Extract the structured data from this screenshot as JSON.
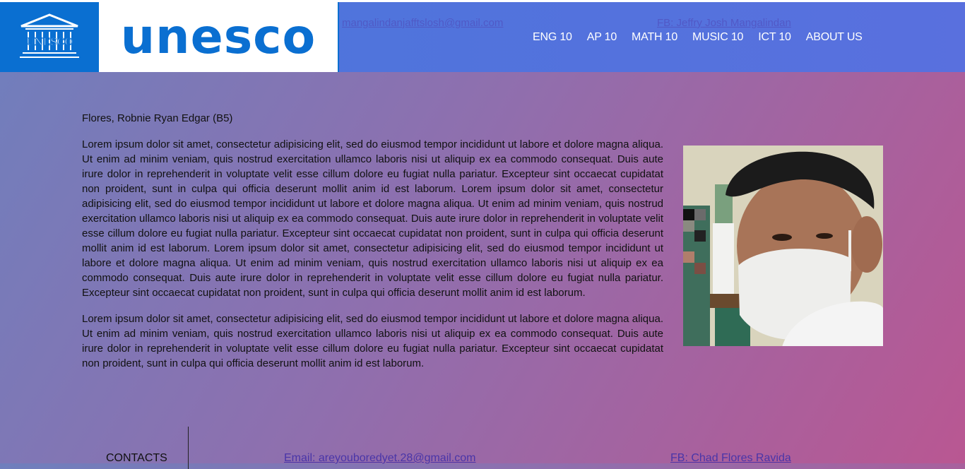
{
  "header": {
    "logo_small_text": "UNESCO",
    "logo_word": "unesco",
    "ghost_left_link": "mangalindanjafftslosh@gmail.com",
    "ghost_right_link": "FB: Jeffry Josh Mangalindan",
    "nav": [
      "ENG 10",
      "AP 10",
      "MATH 10",
      "MUSIC 10",
      "ICT 10",
      "ABOUT US"
    ]
  },
  "main": {
    "name": "Flores, Robnie Ryan Edgar (B5)",
    "paragraph_1": "Lorem ipsum dolor sit amet, consectetur adipisicing elit, sed do eiusmod tempor incididunt ut labore et dolore magna aliqua. Ut enim ad minim veniam, quis nostrud exercitation ullamco laboris nisi ut aliquip ex ea commodo consequat. Duis aute irure dolor in reprehenderit in voluptate velit esse cillum dolore eu fugiat nulla pariatur. Excepteur sint occaecat cupidatat non proident, sunt in culpa qui officia deserunt mollit anim id est laborum. Lorem ipsum dolor sit amet, consectetur adipisicing elit, sed do eiusmod tempor incididunt ut labore et dolore magna aliqua. Ut enim ad minim veniam, quis nostrud exercitation ullamco laboris nisi ut aliquip ex ea commodo consequat. Duis aute irure dolor in reprehenderit in voluptate velit esse cillum dolore eu fugiat nulla pariatur. Excepteur sint occaecat cupidatat non proident, sunt in culpa qui officia deserunt mollit anim id est laborum. Lorem ipsum dolor sit amet, consectetur adipisicing elit, sed do eiusmod tempor incididunt ut labore et dolore magna aliqua. Ut enim ad minim veniam, quis nostrud exercitation ullamco laboris nisi ut aliquip ex ea commodo consequat. Duis aute irure dolor in reprehenderit in voluptate velit esse cillum dolore eu fugiat nulla pariatur. Excepteur sint occaecat cupidatat non proident, sunt in culpa qui officia deserunt mollit anim id est laborum.",
    "paragraph_2": "Lorem ipsum dolor sit amet, consectetur adipisicing elit, sed do eiusmod tempor incididunt ut labore et dolore magna aliqua. Ut enim ad minim veniam, quis nostrud exercitation ullamco laboris nisi ut aliquip ex ea commodo consequat. Duis aute irure dolor in reprehenderit in voluptate velit esse cillum dolore eu fugiat nulla pariatur. Excepteur sint occaecat cupidatat non proident, sunt in culpa qui officia deserunt mollit anim id est laborum.",
    "photo_icon": "student-photo"
  },
  "footer": {
    "title": "CONTACTS",
    "email": "Email: areyouboredyet.28@gmail.com",
    "fb": "FB: Chad Flores Ravida"
  },
  "colors": {
    "header_bg": "#5970de",
    "logo_blue": "#0a6fd1",
    "link": "#4935a8"
  }
}
